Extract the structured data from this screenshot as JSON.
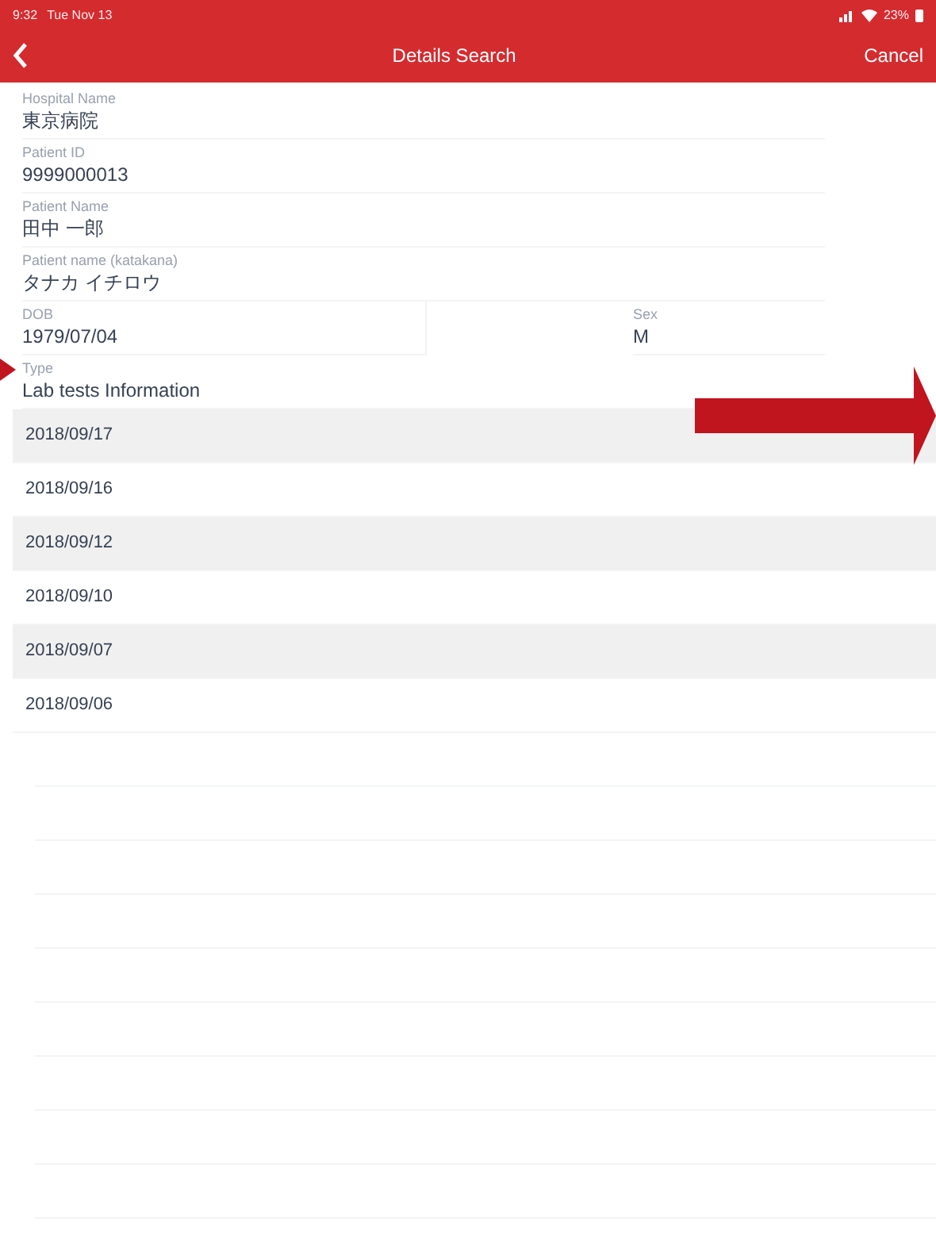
{
  "status_bar": {
    "time": "9:32",
    "date": "Tue Nov 13",
    "battery": "23%"
  },
  "nav": {
    "title": "Details Search",
    "cancel": "Cancel"
  },
  "fields": [
    {
      "label": "Hospital Name",
      "value": "東京病院"
    },
    {
      "label": "Patient ID",
      "value": "9999000013"
    },
    {
      "label": "Patient Name",
      "value": "田中 一郎"
    },
    {
      "label": "Patient name (katakana)",
      "value": "タナカ イチロウ"
    }
  ],
  "dob": {
    "label": "DOB",
    "value": "1979/07/04"
  },
  "sex": {
    "label": "Sex",
    "value": "M"
  },
  "type": {
    "label": "Type",
    "value": "Lab tests Information"
  },
  "dates": [
    "2018/09/17",
    "2018/09/16",
    "2018/09/12",
    "2018/09/10",
    "2018/09/07",
    "2018/09/06"
  ]
}
